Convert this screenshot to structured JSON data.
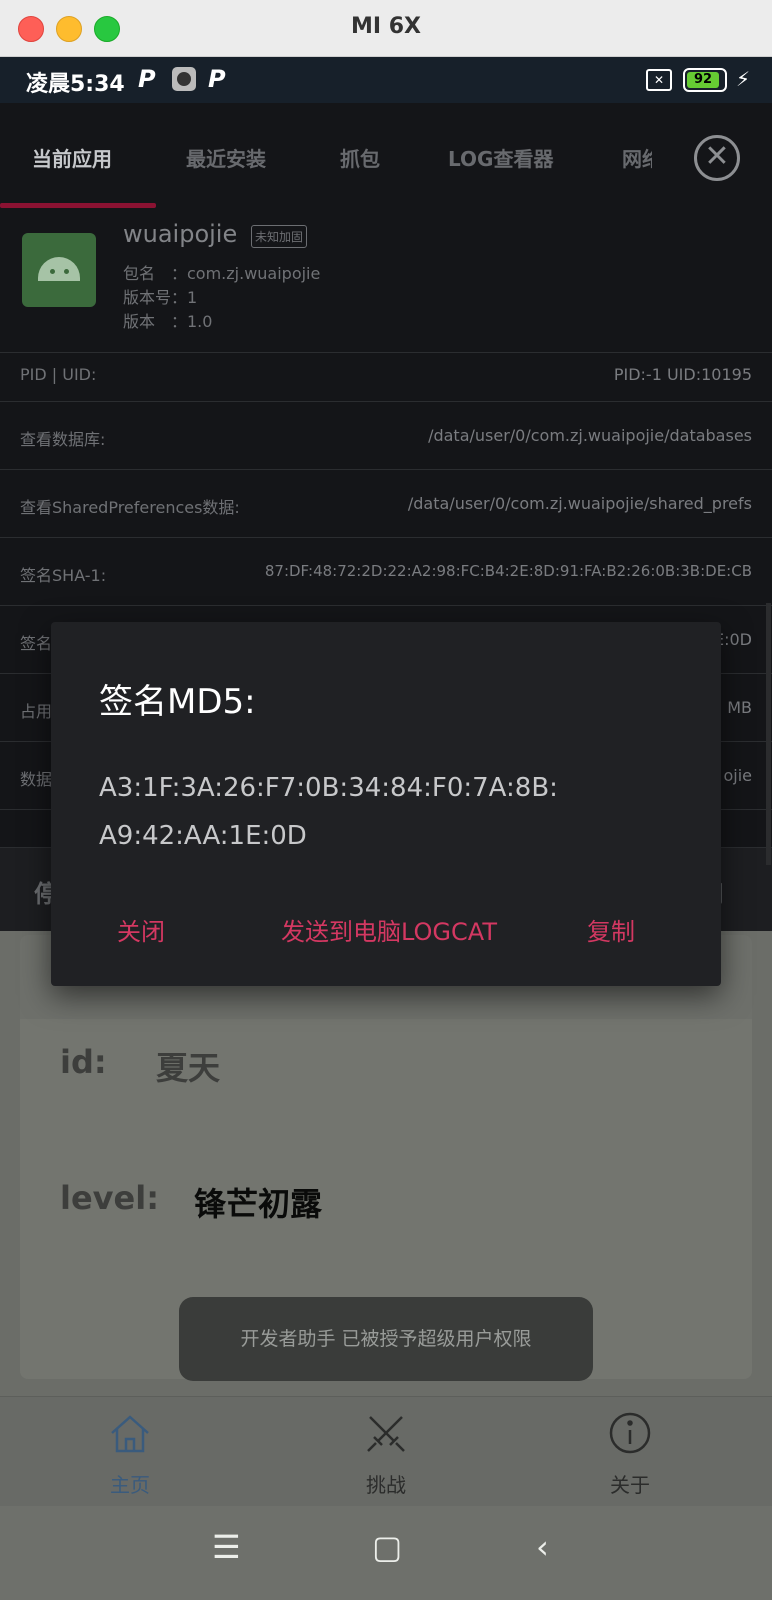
{
  "window": {
    "title": "MI 6X"
  },
  "status_bar": {
    "time": "凌晨5:34",
    "p_icon": "P",
    "battery": "92",
    "bolt": "⚡"
  },
  "tabs": {
    "items": [
      "当前应用",
      "最近安装",
      "抓包",
      "LOG查看器",
      "网络"
    ],
    "active_index": 0,
    "close_glyph": "✕"
  },
  "app": {
    "name": "wuaipojie",
    "badge": "未知加固",
    "package": "包名　：com.zj.wuaipojie",
    "version_code": "版本号：1",
    "version_name": "版本　：1.0"
  },
  "rows": [
    {
      "label": "PID  |  UID:",
      "value": "PID:-1   UID:10195"
    },
    {
      "label": "查看数据库:",
      "value": "/data/user/0/com.zj.wuaipojie/databases"
    },
    {
      "label": "查看SharedPreferences数据:",
      "value": "/data/user/0/com.zj.wuaipojie/shared_prefs"
    },
    {
      "label": "签名SHA-1:",
      "value": "87:DF:48:72:2D:22:A2:98:FC:B4:2E:8D:91:FA:B2:26:0B:3B:DE:CB"
    },
    {
      "label": "签名",
      "value": "E:0D"
    },
    {
      "label": "占用",
      "value": "MB"
    },
    {
      "label": "数据",
      "value": "ojie"
    }
  ],
  "action_bar": {
    "left": "停",
    "right": "用"
  },
  "card": {
    "id_key": "id:",
    "id_value": "夏天",
    "level_key": "level:",
    "level_value": "锋芒初露"
  },
  "toast": "开发者助手 已被授予超级用户权限",
  "bottom_nav": [
    {
      "label": "主页",
      "icon": "home-icon",
      "color": "#3a5b7d"
    },
    {
      "label": "挑战",
      "icon": "crossed-swords-icon",
      "color": "#2b2c2b"
    },
    {
      "label": "关于",
      "icon": "info-icon",
      "color": "#2b2c2b"
    }
  ],
  "system_nav": {
    "menu": "☰",
    "home": "▢",
    "back": "‹"
  },
  "dialog": {
    "title": "签名MD5:",
    "message": "A3:1F:3A:26:F7:0B:34:84:F0:7A:8B:A9:42:AA:1E:0D",
    "buttons": {
      "close": "关闭",
      "send": "发送到电脑LOGCAT",
      "copy": "复制"
    },
    "accent": "#d43862"
  }
}
